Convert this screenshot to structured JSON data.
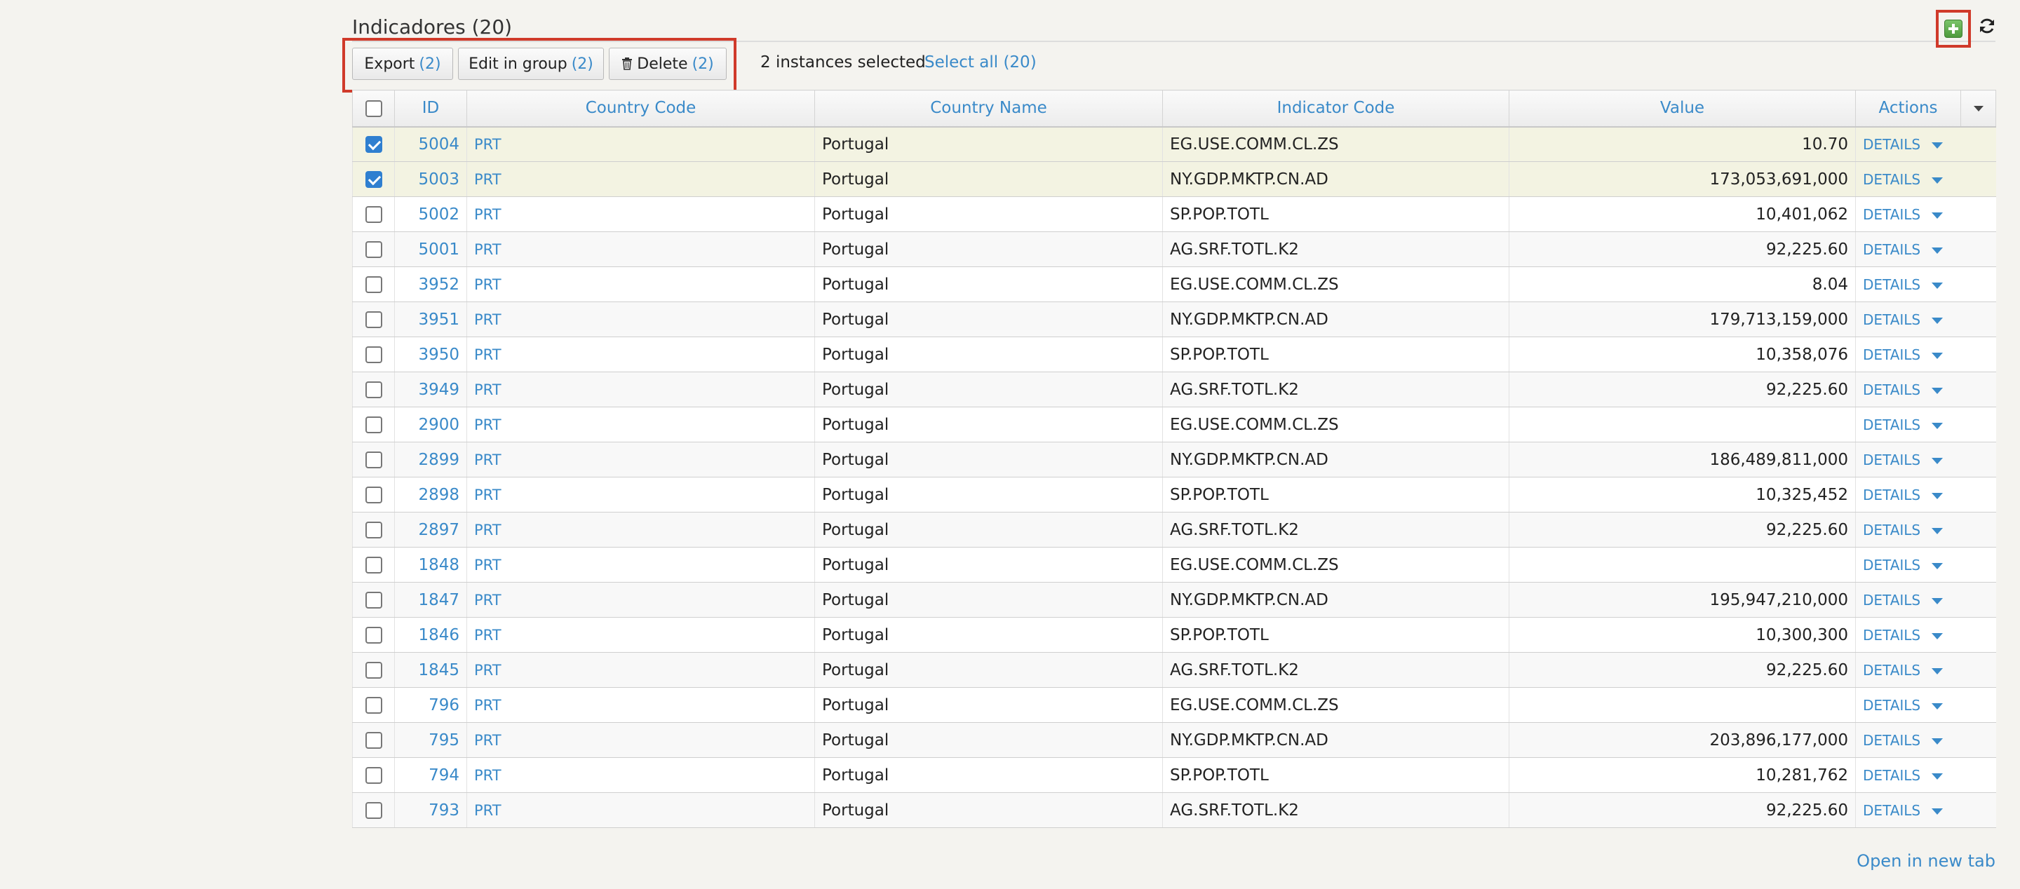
{
  "title": "Indicadores (20)",
  "toolbar": {
    "export_label": "Export",
    "export_count": "(2)",
    "edit_label": "Edit in group",
    "edit_count": "(2)",
    "delete_label": "Delete",
    "delete_count": "(2)",
    "selection_text": "2 instances selected",
    "select_all_label": "Select all",
    "select_all_count": "(20)"
  },
  "columns": [
    "ID",
    "Country Code",
    "Country Name",
    "Indicator Code",
    "Value",
    "Actions"
  ],
  "rows": [
    {
      "id": "5004",
      "cc": "PRT",
      "name": "Portugal",
      "code": "EG.USE.COMM.CL.ZS",
      "value": "10.70",
      "action": "DETAILS",
      "selected": true
    },
    {
      "id": "5003",
      "cc": "PRT",
      "name": "Portugal",
      "code": "NY.GDP.MKTP.CN.AD",
      "value": "173,053,691,000",
      "action": "DETAILS",
      "selected": true
    },
    {
      "id": "5002",
      "cc": "PRT",
      "name": "Portugal",
      "code": "SP.POP.TOTL",
      "value": "10,401,062",
      "action": "DETAILS",
      "selected": false
    },
    {
      "id": "5001",
      "cc": "PRT",
      "name": "Portugal",
      "code": "AG.SRF.TOTL.K2",
      "value": "92,225.60",
      "action": "DETAILS",
      "selected": false
    },
    {
      "id": "3952",
      "cc": "PRT",
      "name": "Portugal",
      "code": "EG.USE.COMM.CL.ZS",
      "value": "8.04",
      "action": "DETAILS",
      "selected": false
    },
    {
      "id": "3951",
      "cc": "PRT",
      "name": "Portugal",
      "code": "NY.GDP.MKTP.CN.AD",
      "value": "179,713,159,000",
      "action": "DETAILS",
      "selected": false
    },
    {
      "id": "3950",
      "cc": "PRT",
      "name": "Portugal",
      "code": "SP.POP.TOTL",
      "value": "10,358,076",
      "action": "DETAILS",
      "selected": false
    },
    {
      "id": "3949",
      "cc": "PRT",
      "name": "Portugal",
      "code": "AG.SRF.TOTL.K2",
      "value": "92,225.60",
      "action": "DETAILS",
      "selected": false
    },
    {
      "id": "2900",
      "cc": "PRT",
      "name": "Portugal",
      "code": "EG.USE.COMM.CL.ZS",
      "value": "",
      "action": "DETAILS",
      "selected": false
    },
    {
      "id": "2899",
      "cc": "PRT",
      "name": "Portugal",
      "code": "NY.GDP.MKTP.CN.AD",
      "value": "186,489,811,000",
      "action": "DETAILS",
      "selected": false
    },
    {
      "id": "2898",
      "cc": "PRT",
      "name": "Portugal",
      "code": "SP.POP.TOTL",
      "value": "10,325,452",
      "action": "DETAILS",
      "selected": false
    },
    {
      "id": "2897",
      "cc": "PRT",
      "name": "Portugal",
      "code": "AG.SRF.TOTL.K2",
      "value": "92,225.60",
      "action": "DETAILS",
      "selected": false
    },
    {
      "id": "1848",
      "cc": "PRT",
      "name": "Portugal",
      "code": "EG.USE.COMM.CL.ZS",
      "value": "",
      "action": "DETAILS",
      "selected": false
    },
    {
      "id": "1847",
      "cc": "PRT",
      "name": "Portugal",
      "code": "NY.GDP.MKTP.CN.AD",
      "value": "195,947,210,000",
      "action": "DETAILS",
      "selected": false
    },
    {
      "id": "1846",
      "cc": "PRT",
      "name": "Portugal",
      "code": "SP.POP.TOTL",
      "value": "10,300,300",
      "action": "DETAILS",
      "selected": false
    },
    {
      "id": "1845",
      "cc": "PRT",
      "name": "Portugal",
      "code": "AG.SRF.TOTL.K2",
      "value": "92,225.60",
      "action": "DETAILS",
      "selected": false
    },
    {
      "id": "796",
      "cc": "PRT",
      "name": "Portugal",
      "code": "EG.USE.COMM.CL.ZS",
      "value": "",
      "action": "DETAILS",
      "selected": false
    },
    {
      "id": "795",
      "cc": "PRT",
      "name": "Portugal",
      "code": "NY.GDP.MKTP.CN.AD",
      "value": "203,896,177,000",
      "action": "DETAILS",
      "selected": false
    },
    {
      "id": "794",
      "cc": "PRT",
      "name": "Portugal",
      "code": "SP.POP.TOTL",
      "value": "10,281,762",
      "action": "DETAILS",
      "selected": false
    },
    {
      "id": "793",
      "cc": "PRT",
      "name": "Portugal",
      "code": "AG.SRF.TOTL.K2",
      "value": "92,225.60",
      "action": "DETAILS",
      "selected": false
    }
  ],
  "footer": {
    "open_tab_label": "Open in new tab"
  },
  "colors": {
    "link": "#3a8ac9",
    "highlight": "#d03a2a",
    "selected_row": "#f3f3e2",
    "add_green": "#5aa546"
  }
}
